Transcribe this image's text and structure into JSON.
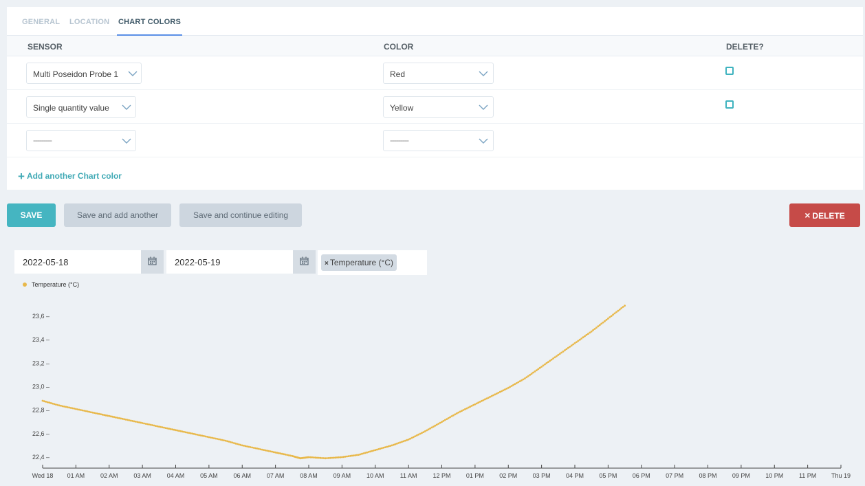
{
  "tabs": [
    {
      "label": "GENERAL",
      "active": false
    },
    {
      "label": "LOCATION",
      "active": false
    },
    {
      "label": "CHART COLORS",
      "active": true
    }
  ],
  "table": {
    "headers": {
      "sensor": "SENSOR",
      "color": "COLOR",
      "delete": "DELETE?"
    },
    "rows": [
      {
        "sensor": "Multi Poseidon Probe 1",
        "color": "Red",
        "has_delete": true
      },
      {
        "sensor": "Single quantity value",
        "color": "Yellow",
        "has_delete": true
      },
      {
        "sensor": "---------",
        "color": "---------",
        "has_delete": false
      }
    ],
    "add_link": "Add another Chart color"
  },
  "actions": {
    "save": "SAVE",
    "save_add": "Save and add another",
    "save_continue": "Save and continue editing",
    "delete": "DELETE",
    "delete_icon": "×"
  },
  "filters": {
    "start_date": "2022-05-18",
    "end_date": "2022-05-19",
    "tag_remove": "×",
    "tag": "Temperature (°C)"
  },
  "colors": {
    "accent": "#45b5c1",
    "danger": "#c64b48",
    "series": "#e8b84a"
  },
  "chart_data": {
    "type": "scatter",
    "series": [
      {
        "name": "Temperature (°C)",
        "color": "#e8b84a",
        "x_hours": [
          0.0,
          0.5,
          1.0,
          1.5,
          2.0,
          2.5,
          3.0,
          3.5,
          4.0,
          4.5,
          5.0,
          5.5,
          6.0,
          6.5,
          7.0,
          7.5,
          7.75,
          8.0,
          8.5,
          9.0,
          9.5,
          10.0,
          10.5,
          11.0,
          11.5,
          12.0,
          12.5,
          13.0,
          13.5,
          14.0,
          14.5,
          15.0,
          15.5,
          16.0,
          16.5,
          17.0,
          17.5
        ],
        "values": [
          22.88,
          22.84,
          22.81,
          22.78,
          22.75,
          22.72,
          22.69,
          22.66,
          22.63,
          22.6,
          22.57,
          22.54,
          22.5,
          22.47,
          22.44,
          22.41,
          22.39,
          22.4,
          22.39,
          22.4,
          22.42,
          22.46,
          22.5,
          22.55,
          22.62,
          22.7,
          22.78,
          22.85,
          22.92,
          22.99,
          23.07,
          23.17,
          23.27,
          23.37,
          23.47,
          23.58,
          23.69
        ]
      }
    ],
    "x_tick_labels": [
      "Wed 18",
      "01 AM",
      "02 AM",
      "03 AM",
      "04 AM",
      "05 AM",
      "06 AM",
      "07 AM",
      "08 AM",
      "09 AM",
      "10 AM",
      "11 AM",
      "12 PM",
      "01 PM",
      "02 PM",
      "03 PM",
      "04 PM",
      "05 PM",
      "06 PM",
      "07 PM",
      "08 PM",
      "09 PM",
      "10 PM",
      "11 PM",
      "Thu 19"
    ],
    "y_ticks": [
      22.4,
      22.6,
      22.8,
      23.0,
      23.2,
      23.4,
      23.6
    ],
    "y_tick_labels": [
      "22,4 –",
      "22,6 –",
      "22,8 –",
      "23,0 –",
      "23,2 –",
      "23,4 –",
      "23,6 –"
    ],
    "xlim_hours": [
      0,
      24
    ],
    "ylim": [
      22.3,
      23.75
    ],
    "legend": "top-left",
    "grid": false
  }
}
